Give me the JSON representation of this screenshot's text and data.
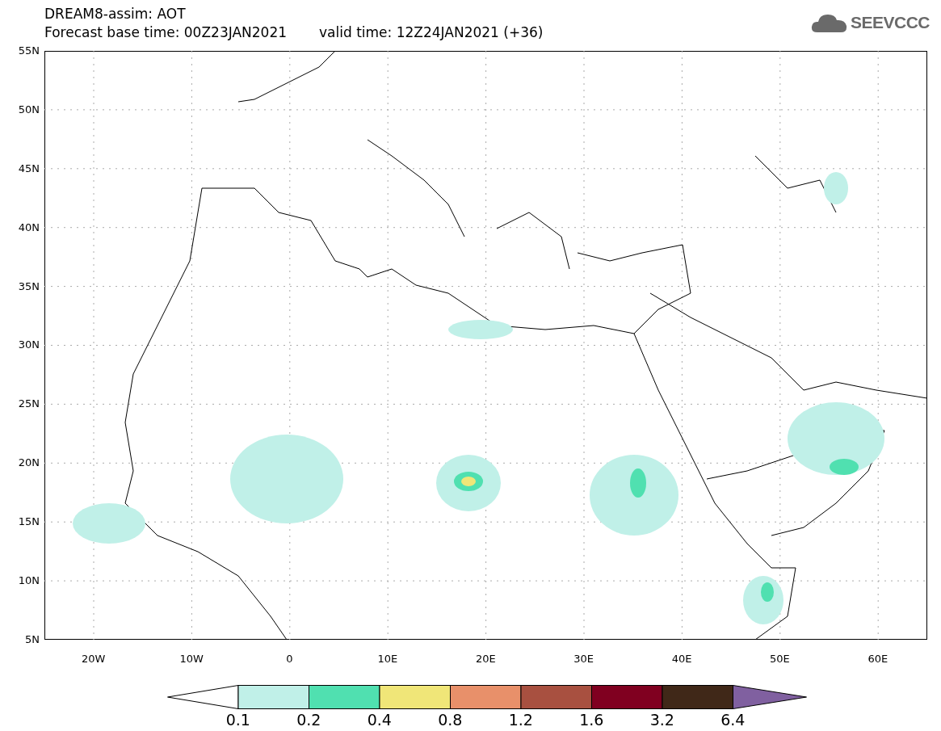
{
  "header": {
    "title": "DREAM8-assim: AOT",
    "base_time": "Forecast base time: 00Z23JAN2021",
    "valid_time": "valid time: 12Z24JAN2021 (+36)"
  },
  "logo": {
    "text": "SEEVCCC"
  },
  "map": {
    "y_labels": [
      "55N",
      "50N",
      "45N",
      "40N",
      "35N",
      "30N",
      "25N",
      "20N",
      "15N",
      "10N",
      "5N"
    ],
    "x_labels": [
      "20W",
      "10W",
      "0",
      "10E",
      "20E",
      "30E",
      "40E",
      "50E",
      "60E"
    ]
  },
  "colorbar": {
    "segments": [
      {
        "kind": "low",
        "color": "#ffffff"
      },
      {
        "kind": "band",
        "color": "#c0f0e8"
      },
      {
        "kind": "band",
        "color": "#50e0b0"
      },
      {
        "kind": "band",
        "color": "#f0e678"
      },
      {
        "kind": "band",
        "color": "#e8906a"
      },
      {
        "kind": "band",
        "color": "#a85040"
      },
      {
        "kind": "band",
        "color": "#800020"
      },
      {
        "kind": "band",
        "color": "#402818"
      },
      {
        "kind": "high",
        "color": "#8060a0"
      }
    ],
    "labels": [
      "0.1",
      "0.2",
      "0.4",
      "0.8",
      "1.2",
      "1.6",
      "3.2",
      "6.4"
    ]
  }
}
